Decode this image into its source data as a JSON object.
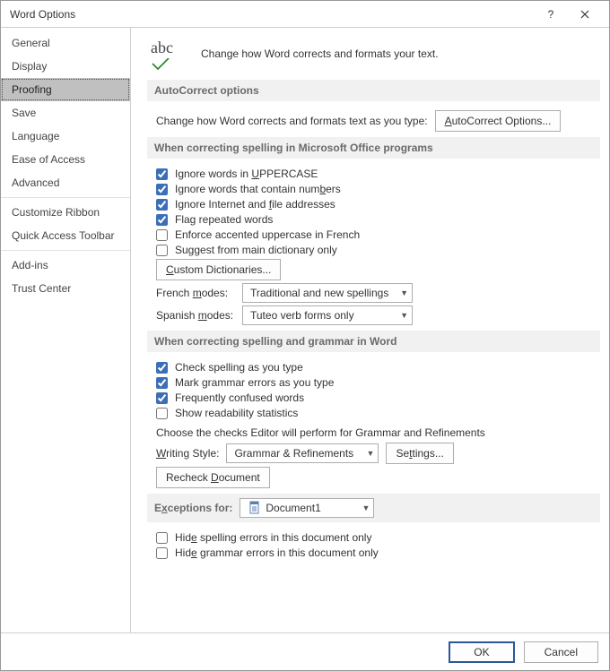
{
  "window": {
    "title": "Word Options"
  },
  "sidebar": {
    "items": [
      {
        "label": "General"
      },
      {
        "label": "Display"
      },
      {
        "label": "Proofing",
        "selected": true
      },
      {
        "label": "Save"
      },
      {
        "label": "Language"
      },
      {
        "label": "Ease of Access"
      },
      {
        "label": "Advanced"
      },
      {
        "label": "Customize Ribbon"
      },
      {
        "label": "Quick Access Toolbar"
      },
      {
        "label": "Add-ins"
      },
      {
        "label": "Trust Center"
      }
    ]
  },
  "header": {
    "icon_text": "abc",
    "description": "Change how Word corrects and formats your text."
  },
  "autocorrect": {
    "heading": "AutoCorrect options",
    "line_pre": "Change how Word corrects and formats text as you type:",
    "button_pre": "A",
    "button_mid": "utoCorrect Options..."
  },
  "office_spelling": {
    "heading": "When correcting spelling in Microsoft Office programs",
    "cb_uppercase_pre": "Ignore words in ",
    "cb_uppercase_u": "U",
    "cb_uppercase_post": "PPERCASE",
    "cb_numbers_pre": "Ignore words that contain num",
    "cb_numbers_u": "b",
    "cb_numbers_post": "ers",
    "cb_internet_pre": "Ignore Internet and ",
    "cb_internet_u": "f",
    "cb_internet_post": "ile addresses",
    "cb_repeated": "Flag repeated words",
    "cb_french": "Enforce accented uppercase in French",
    "cb_dictionary": "Suggest from main dictionary only",
    "btn_custom_u": "C",
    "btn_custom_post": "ustom Dictionaries...",
    "label_french_u": "m",
    "label_french_pre": "French ",
    "label_french_post": "odes:",
    "combo_french": "Traditional and new spellings",
    "label_spanish_u": "m",
    "label_spanish_pre": "Spanis",
    "label_spanish_mid": "h ",
    "label_spanish_post": "odes:",
    "combo_spanish": "Tuteo verb forms only"
  },
  "word_spelling": {
    "heading": "When correcting spelling and grammar in Word",
    "cb_check_spelling": "Check spelling as you type",
    "cb_mark_grammar": "Mark grammar errors as you type",
    "cb_confused": "Frequently confused words",
    "cb_readability": "Show readability statistics",
    "note": "Choose the checks Editor will perform for Grammar and Refinements",
    "label_style_u": "W",
    "label_style_post": "riting Style:",
    "combo_style": "Grammar & Refinements",
    "btn_settings_u": "t",
    "btn_settings_pre": "Se",
    "btn_settings_post": "tings...",
    "btn_recheck_u": "D",
    "btn_recheck_pre": "Recheck ",
    "btn_recheck_post": "ocument"
  },
  "exceptions": {
    "heading_u": "x",
    "heading_pre": "E",
    "heading_post": "ceptions for:",
    "combo": "Document1",
    "cb_hide_spelling_u": "e",
    "cb_hide_spelling_pre": "Hid",
    "cb_hide_spelling_post": " spelling errors in this document only",
    "cb_hide_grammar_u": "e",
    "cb_hide_grammar_pre": "Hid",
    "cb_hide_grammar_post": " grammar errors in this document only"
  },
  "footer": {
    "ok": "OK",
    "cancel": "Cancel"
  }
}
